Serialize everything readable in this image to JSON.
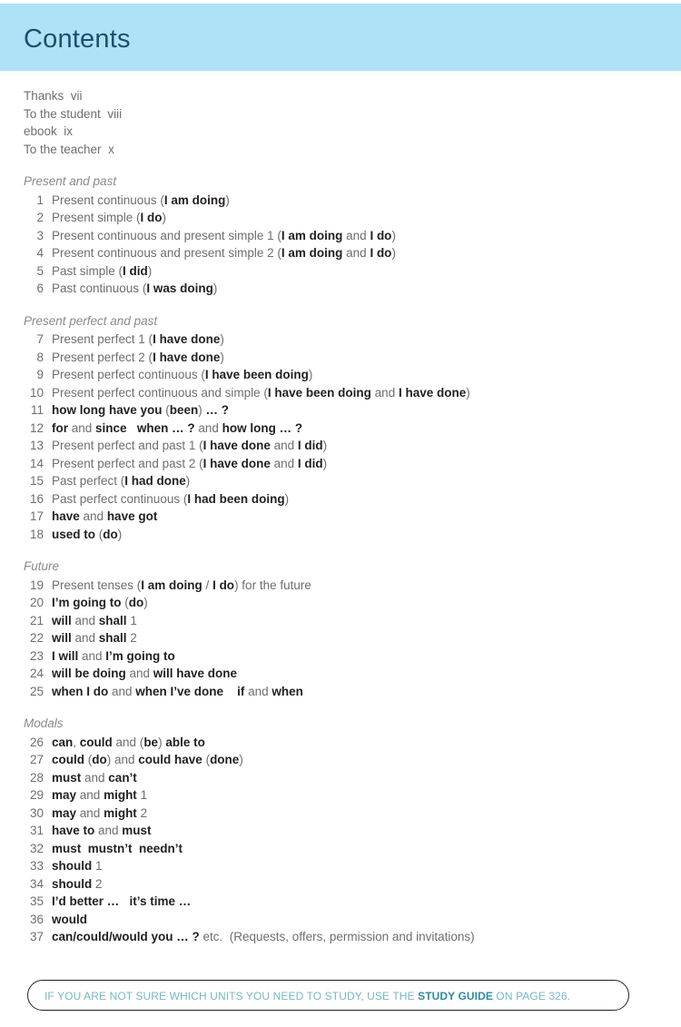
{
  "header": {
    "title": "Contents",
    "band_color": "#ade2f7",
    "title_color": "#1d4f6e"
  },
  "frontmatter": [
    {
      "label": "Thanks",
      "page": "vii"
    },
    {
      "label": "To the student",
      "page": "viii"
    },
    {
      "label": "ebook",
      "page": "ix"
    },
    {
      "label": "To the teacher",
      "page": "x"
    }
  ],
  "sections": [
    {
      "heading": "Present and past",
      "entries": [
        {
          "num": "1",
          "html": "Present continuous (<b>I am doing</b>)"
        },
        {
          "num": "2",
          "html": "Present simple (<b>I do</b>)"
        },
        {
          "num": "3",
          "html": "Present continuous and present simple 1 (<b>I am doing</b> and <b>I do</b>)"
        },
        {
          "num": "4",
          "html": "Present continuous and present simple 2 (<b>I am doing</b> and <b>I do</b>)"
        },
        {
          "num": "5",
          "html": "Past simple (<b>I did</b>)"
        },
        {
          "num": "6",
          "html": "Past continuous (<b>I was doing</b>)"
        }
      ]
    },
    {
      "heading": "Present perfect and past",
      "entries": [
        {
          "num": "7",
          "html": "Present perfect 1 (<b>I have done</b>)"
        },
        {
          "num": "8",
          "html": "Present perfect 2 (<b>I have done</b>)"
        },
        {
          "num": "9",
          "html": "Present perfect continuous (<b>I have been doing</b>)"
        },
        {
          "num": "10",
          "html": "Present perfect continuous and simple (<b>I have been doing</b> and <b>I have done</b>)"
        },
        {
          "num": "11",
          "html": "<b>how long have you</b> (<b>been</b>) <b>… ?</b>"
        },
        {
          "num": "12",
          "html": "<b>for</b> and <b>since</b>   <b>when … ?</b> and <b>how long … ?</b>"
        },
        {
          "num": "13",
          "html": "Present perfect and past 1 (<b>I have done</b> and <b>I did</b>)"
        },
        {
          "num": "14",
          "html": "Present perfect and past 2 (<b>I have done</b> and <b>I did</b>)"
        },
        {
          "num": "15",
          "html": "Past perfect (<b>I had done</b>)"
        },
        {
          "num": "16",
          "html": "Past perfect continuous (<b>I had been doing</b>)"
        },
        {
          "num": "17",
          "html": "<b>have</b> and <b>have got</b>"
        },
        {
          "num": "18",
          "html": "<b>used to</b> (<b>do</b>)"
        }
      ]
    },
    {
      "heading": "Future",
      "entries": [
        {
          "num": "19",
          "html": "Present tenses (<b>I am doing</b> / <b>I do</b>) for the future"
        },
        {
          "num": "20",
          "html": "<b>I’m going to</b> (<b>do</b>)"
        },
        {
          "num": "21",
          "html": "<b>will</b> and <b>shall</b> 1"
        },
        {
          "num": "22",
          "html": "<b>will</b> and <b>shall</b> 2"
        },
        {
          "num": "23",
          "html": "<b>I will</b> and <b>I’m going to</b>"
        },
        {
          "num": "24",
          "html": "<b>will be doing</b> and <b>will have done</b>"
        },
        {
          "num": "25",
          "html": "<b>when I do</b> and <b>when I’ve done</b>    <b>if</b> and <b>when</b>"
        }
      ]
    },
    {
      "heading": "Modals",
      "entries": [
        {
          "num": "26",
          "html": "<b>can</b>, <b>could</b> and (<b>be</b>) <b>able to</b>"
        },
        {
          "num": "27",
          "html": "<b>could</b> (<b>do</b>) and <b>could have</b> (<b>done</b>)"
        },
        {
          "num": "28",
          "html": "<b>must</b> and <b>can’t</b>"
        },
        {
          "num": "29",
          "html": "<b>may</b> and <b>might</b> 1"
        },
        {
          "num": "30",
          "html": "<b>may</b> and <b>might</b> 2"
        },
        {
          "num": "31",
          "html": "<b>have to</b> and <b>must</b>"
        },
        {
          "num": "32",
          "html": "<b>must  mustn’t  needn’t</b>"
        },
        {
          "num": "33",
          "html": "<b>should</b> 1"
        },
        {
          "num": "34",
          "html": "<b>should</b> 2"
        },
        {
          "num": "35",
          "html": "<b>I’d better …</b>   <b>it’s time …</b>"
        },
        {
          "num": "36",
          "html": "<b>would</b>"
        },
        {
          "num": "37",
          "html": "<b>can/could/would you … ?</b> etc.  (Requests, offers, permission and invitations)"
        }
      ]
    }
  ],
  "footer": {
    "html": "IF YOU ARE NOT SURE WHICH UNITS YOU NEED TO STUDY, USE THE <b>STUDY GUIDE</b> ON PAGE 326.",
    "text_color": "#74b9c6",
    "accent_color": "#2a8d9f"
  }
}
